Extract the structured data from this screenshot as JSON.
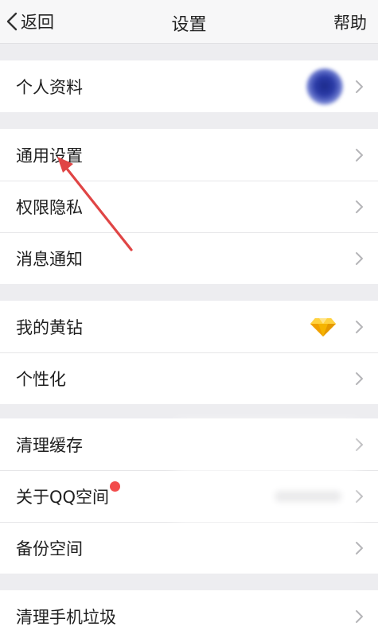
{
  "nav": {
    "back_label": "返回",
    "title": "设置",
    "help_label": "帮助"
  },
  "groups": [
    {
      "items": [
        {
          "label": "个人资料",
          "accessory": "avatar"
        }
      ]
    },
    {
      "items": [
        {
          "label": "通用设置"
        },
        {
          "label": "权限隐私"
        },
        {
          "label": "消息通知"
        }
      ]
    },
    {
      "items": [
        {
          "label": "我的黄钻",
          "accessory": "diamond-icon"
        },
        {
          "label": "个性化"
        }
      ]
    },
    {
      "items": [
        {
          "label": "清理缓存"
        },
        {
          "label": "关于QQ空间",
          "badge": "red-dot"
        },
        {
          "label": "备份空间"
        }
      ]
    },
    {
      "items": [
        {
          "label": "清理手机垃圾"
        }
      ]
    }
  ],
  "colors": {
    "background": "#ededf0",
    "cell": "#ffffff",
    "annotation_arrow": "#e04545",
    "badge": "#f24c4c",
    "diamond": "#f5b400"
  }
}
